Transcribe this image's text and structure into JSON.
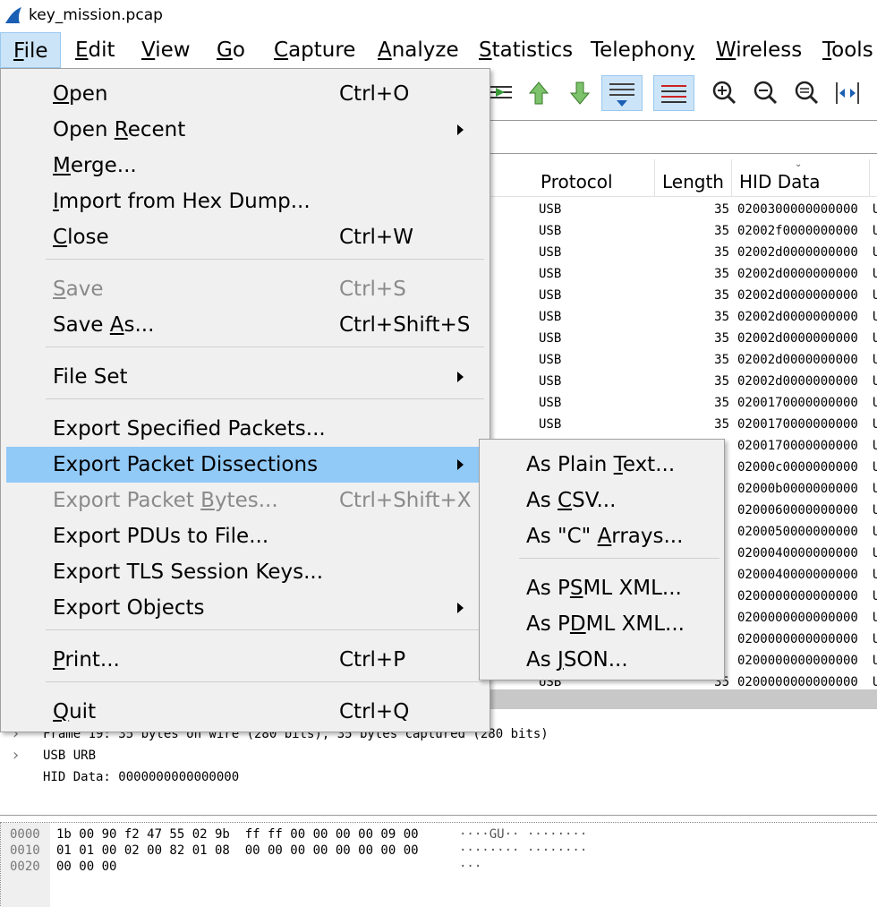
{
  "window": {
    "title": "key_mission.pcap"
  },
  "menubar": {
    "items": [
      {
        "label": "File",
        "u": "F",
        "rest": "ile",
        "active": true
      },
      {
        "label": "Edit",
        "u": "E",
        "rest": "dit"
      },
      {
        "label": "View",
        "u": "V",
        "rest": "iew"
      },
      {
        "label": "Go",
        "u": "G",
        "rest": "o"
      },
      {
        "label": "Capture",
        "u": "C",
        "rest": "apture"
      },
      {
        "label": "Analyze",
        "u": "A",
        "rest": "nalyze"
      },
      {
        "label": "Statistics",
        "u": "S",
        "rest": "tatistics"
      },
      {
        "label": "Telephony",
        "pre": "Telephon",
        "u": "y",
        "rest": ""
      },
      {
        "label": "Wireless",
        "u": "W",
        "rest": "ireless"
      },
      {
        "label": "Tools",
        "u": "T",
        "rest": "ools"
      }
    ]
  },
  "file_menu": {
    "open": {
      "pre": "",
      "u": "O",
      "rest": "pen",
      "shortcut": "Ctrl+O"
    },
    "open_recent": {
      "pre": "Open ",
      "u": "R",
      "rest": "ecent"
    },
    "merge": {
      "pre": "",
      "u": "M",
      "rest": "erge..."
    },
    "import": {
      "pre": "",
      "u": "I",
      "rest": "mport from Hex Dump..."
    },
    "close": {
      "pre": "",
      "u": "C",
      "rest": "lose",
      "shortcut": "Ctrl+W"
    },
    "save": {
      "pre": "",
      "u": "S",
      "rest": "ave",
      "shortcut": "Ctrl+S"
    },
    "save_as": {
      "pre": "Save ",
      "u": "A",
      "rest": "s...",
      "shortcut": "Ctrl+Shift+S"
    },
    "file_set": {
      "label": "File Set"
    },
    "export_specified": {
      "label": "Export Specified Packets..."
    },
    "export_dissections": {
      "label": "Export Packet Dissections"
    },
    "export_bytes": {
      "pre": "Export Packet ",
      "u": "B",
      "rest": "ytes...",
      "shortcut": "Ctrl+Shift+X"
    },
    "export_pdus": {
      "label": "Export PDUs to File..."
    },
    "export_tls": {
      "label": "Export TLS Session Keys..."
    },
    "export_objects": {
      "label": "Export Objects"
    },
    "print": {
      "pre": "",
      "u": "P",
      "rest": "rint...",
      "shortcut": "Ctrl+P"
    },
    "quit": {
      "pre": "",
      "u": "Q",
      "rest": "uit",
      "shortcut": "Ctrl+Q"
    }
  },
  "submenu": {
    "plain": {
      "pre": "As Plain ",
      "u": "T",
      "rest": "ext..."
    },
    "csv": {
      "pre": "As ",
      "u": "C",
      "rest": "SV..."
    },
    "carrays": {
      "pre": "As \"C\" ",
      "u": "A",
      "rest": "rrays..."
    },
    "psml": {
      "pre": "As P",
      "u": "S",
      "rest": "ML XML..."
    },
    "pdml": {
      "pre": "As P",
      "u": "D",
      "rest": "ML XML..."
    },
    "json": {
      "pre": "As ",
      "u": "J",
      "rest": "SON..."
    }
  },
  "packet_list": {
    "columns": [
      "Protocol",
      "Length",
      "HID Data"
    ],
    "rows": [
      {
        "protocol": "USB",
        "length": "35",
        "hid": "0200300000000000",
        "more": "U"
      },
      {
        "protocol": "USB",
        "length": "35",
        "hid": "02002f0000000000",
        "more": "U"
      },
      {
        "protocol": "USB",
        "length": "35",
        "hid": "02002d0000000000",
        "more": "U"
      },
      {
        "protocol": "USB",
        "length": "35",
        "hid": "02002d0000000000",
        "more": "U"
      },
      {
        "protocol": "USB",
        "length": "35",
        "hid": "02002d0000000000",
        "more": "U"
      },
      {
        "protocol": "USB",
        "length": "35",
        "hid": "02002d0000000000",
        "more": "U"
      },
      {
        "protocol": "USB",
        "length": "35",
        "hid": "02002d0000000000",
        "more": "U"
      },
      {
        "protocol": "USB",
        "length": "35",
        "hid": "02002d0000000000",
        "more": "U"
      },
      {
        "protocol": "USB",
        "length": "35",
        "hid": "02002d0000000000",
        "more": "U"
      },
      {
        "protocol": "USB",
        "length": "35",
        "hid": "0200170000000000",
        "more": "U"
      },
      {
        "protocol": "USB",
        "length": "35",
        "hid": "0200170000000000",
        "more": "U"
      },
      {
        "protocol": "",
        "length": "",
        "hid": "0200170000000000",
        "more": "U"
      },
      {
        "protocol": "",
        "length": "",
        "hid": "02000c0000000000",
        "more": "U"
      },
      {
        "protocol": "",
        "length": "",
        "hid": "02000b0000000000",
        "more": "U"
      },
      {
        "protocol": "",
        "length": "",
        "hid": "0200060000000000",
        "more": "U"
      },
      {
        "protocol": "",
        "length": "",
        "hid": "0200050000000000",
        "more": "U"
      },
      {
        "protocol": "",
        "length": "",
        "hid": "0200040000000000",
        "more": "U"
      },
      {
        "protocol": "",
        "length": "",
        "hid": "0200040000000000",
        "more": "U"
      },
      {
        "protocol": "",
        "length": "",
        "hid": "0200000000000000",
        "more": "U"
      },
      {
        "protocol": "",
        "length": "",
        "hid": "0200000000000000",
        "more": "U"
      },
      {
        "protocol": "",
        "length": "",
        "hid": "0200000000000000",
        "more": "U"
      },
      {
        "protocol": "",
        "length": "",
        "hid": "0200000000000000",
        "more": "U"
      },
      {
        "protocol": "USB",
        "length": "35",
        "hid": "0200000000000000",
        "more": "U"
      }
    ]
  },
  "details": {
    "frame": "Frame 19: 35 bytes on wire (280 bits), 35 bytes captured (280 bits)",
    "urb": "USB URB",
    "hid": "HID Data: 0000000000000000"
  },
  "bytes": {
    "rows": [
      {
        "offset": "0000",
        "hex": "1b 00 90 f2 47 55 02 9b  ff ff 00 00 00 00 09 00",
        "ascii": "····GU·· ········"
      },
      {
        "offset": "0010",
        "hex": "01 01 00 02 00 82 01 08  00 00 00 00 00 00 00 00",
        "ascii": "········ ········"
      },
      {
        "offset": "0020",
        "hex": "00 00 00",
        "ascii": "···"
      }
    ]
  },
  "colors": {
    "menu_bg": "#f0f0f0",
    "highlight": "#91c9f7",
    "active_menu": "#cce4f7",
    "disabled": "#8a8a8a"
  }
}
